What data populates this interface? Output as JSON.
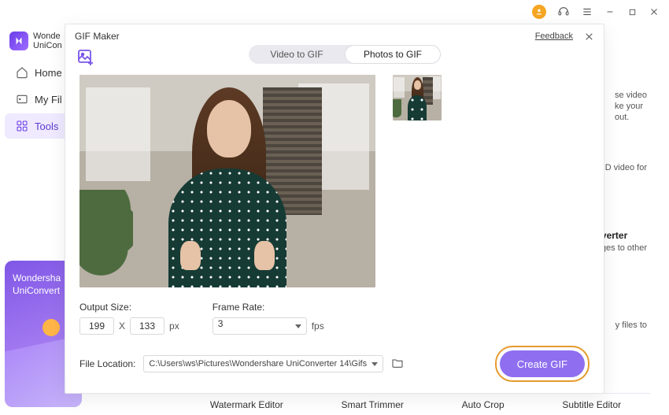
{
  "brand": {
    "line1": "Wonde",
    "line2": "UniCon"
  },
  "sidebar": {
    "items": [
      {
        "label": "Home"
      },
      {
        "label": "My Fil"
      },
      {
        "label": "Tools"
      }
    ]
  },
  "promo": {
    "line1": "Wondersha",
    "line2": "UniConvert"
  },
  "background": {
    "card1": {
      "l1": "se video",
      "l2": "ke your",
      "l3": "out."
    },
    "card2": {
      "l1": "D video for"
    },
    "card3": {
      "title": "verter",
      "l1": "ges to other"
    },
    "card4": {
      "l1": "y files to"
    },
    "tools": [
      "Watermark Editor",
      "Smart Trimmer",
      "Auto Crop",
      "Subtitle Editor"
    ]
  },
  "modal": {
    "title": "GIF Maker",
    "feedback": "Feedback",
    "tabs": {
      "video": "Video to GIF",
      "photos": "Photos to GIF"
    },
    "output_size_label": "Output Size:",
    "width": "199",
    "x": "X",
    "height": "133",
    "px": "px",
    "frame_rate_label": "Frame Rate:",
    "frame_rate_value": "3",
    "fps": "fps",
    "file_location_label": "File Location:",
    "file_location_value": "C:\\Users\\ws\\Pictures\\Wondershare UniConverter 14\\Gifs",
    "create_label": "Create GIF"
  }
}
